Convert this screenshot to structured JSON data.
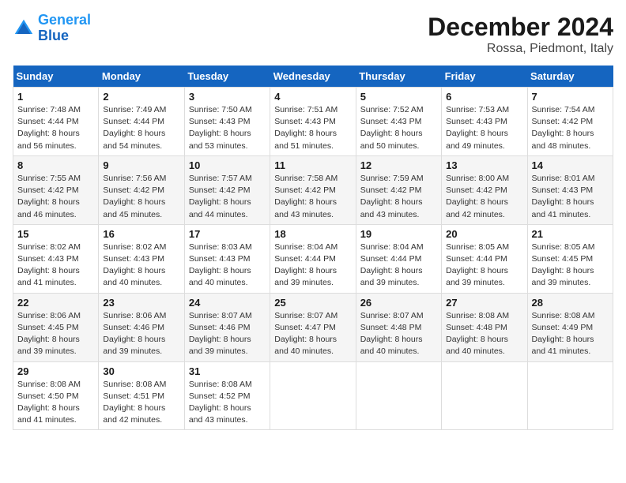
{
  "header": {
    "logo_line1": "General",
    "logo_line2": "Blue",
    "month": "December 2024",
    "location": "Rossa, Piedmont, Italy"
  },
  "days_of_week": [
    "Sunday",
    "Monday",
    "Tuesday",
    "Wednesday",
    "Thursday",
    "Friday",
    "Saturday"
  ],
  "weeks": [
    [
      {
        "day": "1",
        "sunrise": "7:48 AM",
        "sunset": "4:44 PM",
        "daylight": "8 hours and 56 minutes."
      },
      {
        "day": "2",
        "sunrise": "7:49 AM",
        "sunset": "4:44 PM",
        "daylight": "8 hours and 54 minutes."
      },
      {
        "day": "3",
        "sunrise": "7:50 AM",
        "sunset": "4:43 PM",
        "daylight": "8 hours and 53 minutes."
      },
      {
        "day": "4",
        "sunrise": "7:51 AM",
        "sunset": "4:43 PM",
        "daylight": "8 hours and 51 minutes."
      },
      {
        "day": "5",
        "sunrise": "7:52 AM",
        "sunset": "4:43 PM",
        "daylight": "8 hours and 50 minutes."
      },
      {
        "day": "6",
        "sunrise": "7:53 AM",
        "sunset": "4:43 PM",
        "daylight": "8 hours and 49 minutes."
      },
      {
        "day": "7",
        "sunrise": "7:54 AM",
        "sunset": "4:42 PM",
        "daylight": "8 hours and 48 minutes."
      }
    ],
    [
      {
        "day": "8",
        "sunrise": "7:55 AM",
        "sunset": "4:42 PM",
        "daylight": "8 hours and 46 minutes."
      },
      {
        "day": "9",
        "sunrise": "7:56 AM",
        "sunset": "4:42 PM",
        "daylight": "8 hours and 45 minutes."
      },
      {
        "day": "10",
        "sunrise": "7:57 AM",
        "sunset": "4:42 PM",
        "daylight": "8 hours and 44 minutes."
      },
      {
        "day": "11",
        "sunrise": "7:58 AM",
        "sunset": "4:42 PM",
        "daylight": "8 hours and 43 minutes."
      },
      {
        "day": "12",
        "sunrise": "7:59 AM",
        "sunset": "4:42 PM",
        "daylight": "8 hours and 43 minutes."
      },
      {
        "day": "13",
        "sunrise": "8:00 AM",
        "sunset": "4:42 PM",
        "daylight": "8 hours and 42 minutes."
      },
      {
        "day": "14",
        "sunrise": "8:01 AM",
        "sunset": "4:43 PM",
        "daylight": "8 hours and 41 minutes."
      }
    ],
    [
      {
        "day": "15",
        "sunrise": "8:02 AM",
        "sunset": "4:43 PM",
        "daylight": "8 hours and 41 minutes."
      },
      {
        "day": "16",
        "sunrise": "8:02 AM",
        "sunset": "4:43 PM",
        "daylight": "8 hours and 40 minutes."
      },
      {
        "day": "17",
        "sunrise": "8:03 AM",
        "sunset": "4:43 PM",
        "daylight": "8 hours and 40 minutes."
      },
      {
        "day": "18",
        "sunrise": "8:04 AM",
        "sunset": "4:44 PM",
        "daylight": "8 hours and 39 minutes."
      },
      {
        "day": "19",
        "sunrise": "8:04 AM",
        "sunset": "4:44 PM",
        "daylight": "8 hours and 39 minutes."
      },
      {
        "day": "20",
        "sunrise": "8:05 AM",
        "sunset": "4:44 PM",
        "daylight": "8 hours and 39 minutes."
      },
      {
        "day": "21",
        "sunrise": "8:05 AM",
        "sunset": "4:45 PM",
        "daylight": "8 hours and 39 minutes."
      }
    ],
    [
      {
        "day": "22",
        "sunrise": "8:06 AM",
        "sunset": "4:45 PM",
        "daylight": "8 hours and 39 minutes."
      },
      {
        "day": "23",
        "sunrise": "8:06 AM",
        "sunset": "4:46 PM",
        "daylight": "8 hours and 39 minutes."
      },
      {
        "day": "24",
        "sunrise": "8:07 AM",
        "sunset": "4:46 PM",
        "daylight": "8 hours and 39 minutes."
      },
      {
        "day": "25",
        "sunrise": "8:07 AM",
        "sunset": "4:47 PM",
        "daylight": "8 hours and 40 minutes."
      },
      {
        "day": "26",
        "sunrise": "8:07 AM",
        "sunset": "4:48 PM",
        "daylight": "8 hours and 40 minutes."
      },
      {
        "day": "27",
        "sunrise": "8:08 AM",
        "sunset": "4:48 PM",
        "daylight": "8 hours and 40 minutes."
      },
      {
        "day": "28",
        "sunrise": "8:08 AM",
        "sunset": "4:49 PM",
        "daylight": "8 hours and 41 minutes."
      }
    ],
    [
      {
        "day": "29",
        "sunrise": "8:08 AM",
        "sunset": "4:50 PM",
        "daylight": "8 hours and 41 minutes."
      },
      {
        "day": "30",
        "sunrise": "8:08 AM",
        "sunset": "4:51 PM",
        "daylight": "8 hours and 42 minutes."
      },
      {
        "day": "31",
        "sunrise": "8:08 AM",
        "sunset": "4:52 PM",
        "daylight": "8 hours and 43 minutes."
      },
      null,
      null,
      null,
      null
    ]
  ]
}
